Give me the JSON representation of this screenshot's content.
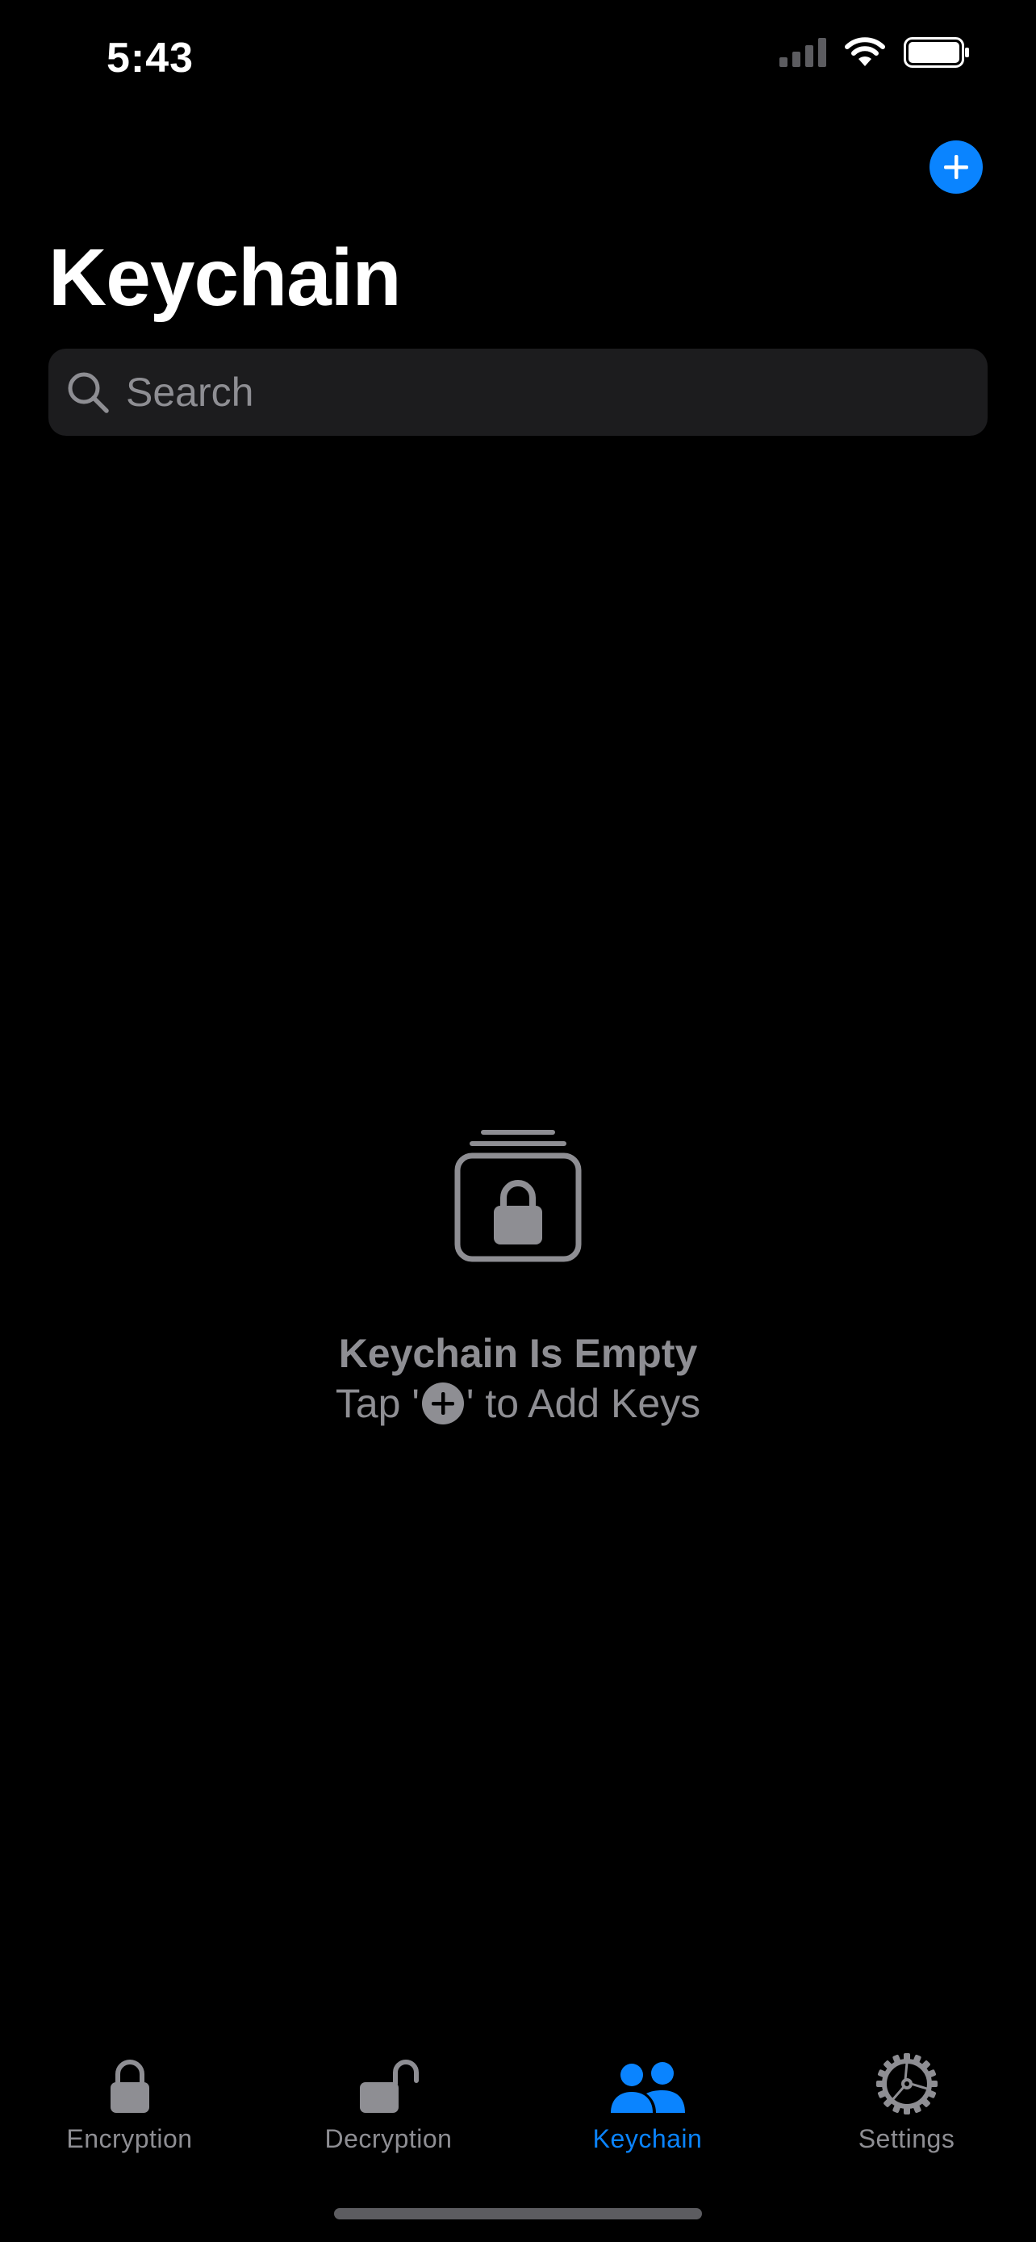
{
  "status_bar": {
    "time": "5:43"
  },
  "header": {
    "title": "Keychain",
    "add_icon": "plus-circle-icon"
  },
  "search": {
    "placeholder": "Search",
    "value": "",
    "icon": "search-icon"
  },
  "empty_state": {
    "icon": "lock-stack-icon",
    "title": "Keychain Is Empty",
    "subtitle_prefix": "Tap '",
    "subtitle_suffix": "' to Add Keys"
  },
  "tab_bar": {
    "active": "Keychain",
    "tabs": [
      {
        "label": "Encryption",
        "icon": "lock-icon"
      },
      {
        "label": "Decryption",
        "icon": "unlock-icon"
      },
      {
        "label": "Keychain",
        "icon": "people-icon"
      },
      {
        "label": "Settings",
        "icon": "gear-icon"
      }
    ]
  },
  "colors": {
    "accent": "#0a84ff",
    "background": "#000000",
    "secondary_text": "#8e8e93",
    "search_background": "#1c1c1e"
  }
}
